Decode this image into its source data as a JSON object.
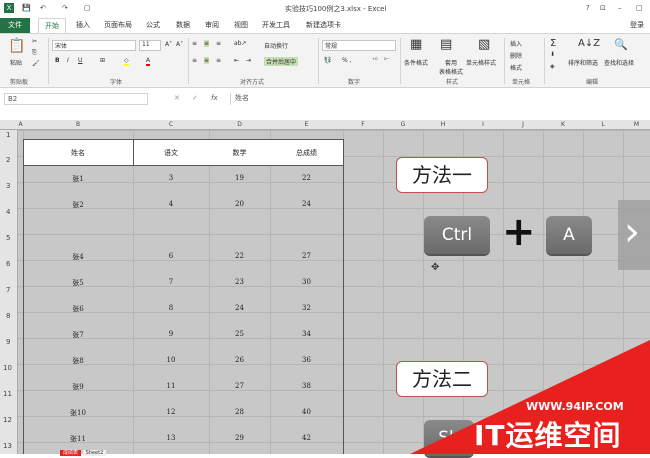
{
  "window": {
    "title": "实验技巧100例之3.xlsx - Excel",
    "help": "?",
    "restore": "⊡",
    "minimize": "–",
    "close": "□",
    "login": "登录"
  },
  "tabs": [
    "文件",
    "开始",
    "插入",
    "页面布局",
    "公式",
    "数据",
    "审阅",
    "视图",
    "开发工具",
    "新建选项卡"
  ],
  "ribbon": {
    "paste": "粘贴",
    "font_name": "宋体",
    "font_size": "11",
    "wrap_text": "自动换行",
    "merge_center": "合并后居中",
    "number_format": "常规",
    "percent": "% ,",
    "cond_format": "条件格式",
    "table_format": "套用\n表格格式",
    "cell_style": "单元格样式",
    "insert": "插入",
    "delete": "删除",
    "format": "格式",
    "sort_filter": "排序和筛选",
    "find_select": "查找和选择",
    "groups": [
      "剪贴板",
      "字体",
      "对齐方式",
      "数字",
      "样式",
      "单元格",
      "编辑"
    ]
  },
  "formula_bar": {
    "name_box": "B2",
    "fx": "fx",
    "content": "姓名"
  },
  "columns": [
    "A",
    "B",
    "C",
    "D",
    "E",
    "F",
    "G",
    "H",
    "I",
    "J",
    "K",
    "L",
    "M"
  ],
  "rows": [
    "1",
    "2",
    "3",
    "4",
    "5",
    "6",
    "7",
    "8",
    "9",
    "10",
    "11",
    "12",
    "13"
  ],
  "table": {
    "headers": [
      "姓名",
      "语文",
      "数学",
      "总成绩"
    ],
    "rows": [
      [
        "张1",
        "3",
        "19",
        "22"
      ],
      [
        "张2",
        "4",
        "20",
        "24"
      ],
      [
        "",
        "",
        "",
        ""
      ],
      [
        "张4",
        "6",
        "22",
        "27"
      ],
      [
        "张5",
        "7",
        "23",
        "30"
      ],
      [
        "张6",
        "8",
        "24",
        "32"
      ],
      [
        "张7",
        "9",
        "25",
        "34"
      ],
      [
        "张8",
        "10",
        "26",
        "36"
      ],
      [
        "张9",
        "11",
        "27",
        "38"
      ],
      [
        "张10",
        "12",
        "28",
        "40"
      ],
      [
        "张11",
        "13",
        "29",
        "42"
      ]
    ]
  },
  "overlay": {
    "method1": "方法一",
    "key_ctrl": "Ctrl",
    "plus": "+",
    "key_a": "A",
    "method2": "方法二",
    "key_shift": "Sh",
    "next_arrow": "›"
  },
  "watermark": {
    "url": "WWW.94IP.COM",
    "brand": "IT运维空间"
  },
  "sheet_tabs": [
    "成绩表",
    "Sheet2"
  ]
}
